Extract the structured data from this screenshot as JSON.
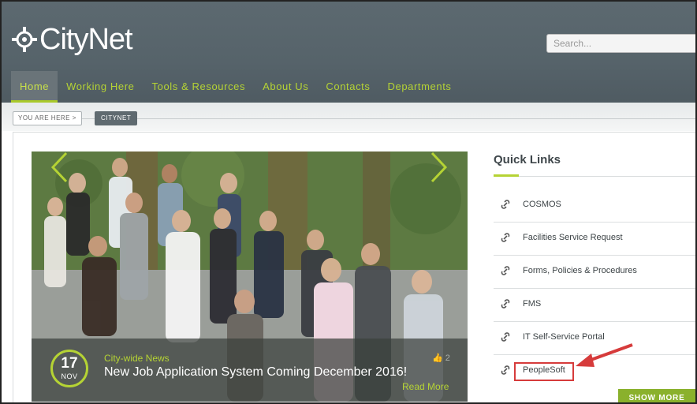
{
  "header": {
    "logo_text": "CityNet",
    "search_placeholder": "Search..."
  },
  "nav": {
    "items": [
      "Home",
      "Working Here",
      "Tools & Resources",
      "About Us",
      "Contacts",
      "Departments"
    ],
    "active_index": 0
  },
  "breadcrumb": {
    "label": "YOU ARE HERE >",
    "current": "CITYNET"
  },
  "slider": {
    "date_day": "17",
    "date_month": "NOV",
    "category": "City-wide News",
    "title": "New Job Application System Coming December 2016!",
    "likes": "2",
    "read_more": "Read More"
  },
  "quick_links": {
    "title": "Quick Links",
    "items": [
      "COSMOS",
      "Facilities Service Request",
      "Forms, Policies & Procedures",
      "FMS",
      "IT Self-Service Portal",
      "PeopleSoft"
    ],
    "highlighted": "PeopleSoft",
    "show_more": "SHOW MORE"
  },
  "colors": {
    "header_bg": "#56636a",
    "accent_green": "#b5d334",
    "button_green": "#8ab12c",
    "annotation_red": "#d63b3b"
  }
}
